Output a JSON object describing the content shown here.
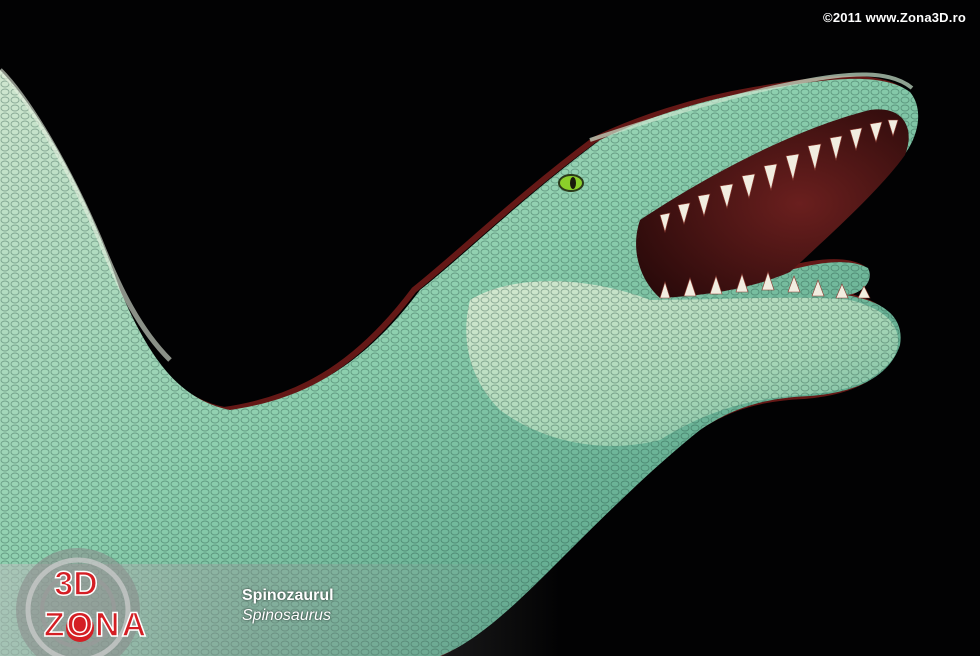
{
  "watermark": {
    "copyright": "©2011 www.Zona3D.ro"
  },
  "logo": {
    "line1": "3D",
    "line2": "ZONA"
  },
  "caption": {
    "title": "Spinozaurul",
    "subtitle": "Spinosaurus"
  },
  "colors": {
    "background": "#020203",
    "skin_cyan": "#7fcfb0",
    "skin_light": "#d8e8c8",
    "anaglyph_red": "#c0302a",
    "logo_red": "#d41e24"
  },
  "icons": {
    "logo": "zona3d-logo"
  }
}
